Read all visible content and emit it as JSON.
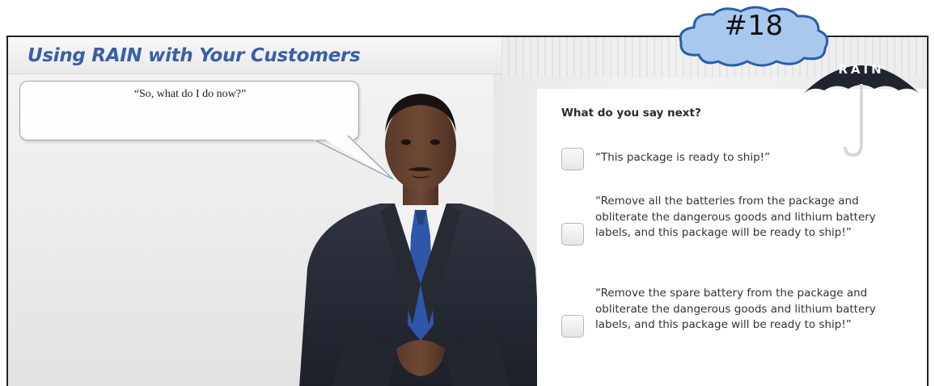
{
  "header": {
    "title": "Using RAIN with Your Customers"
  },
  "speech_bubble": {
    "quote": "“So, what do I do now?”"
  },
  "quiz": {
    "question": "What do you say next?",
    "options": [
      {
        "label": "“This package is ready to ship!”",
        "checked": false
      },
      {
        "label": "“Remove all the batteries from the package and obliterate the dangerous goods and lithium battery labels, and this package will be ready to ship!”",
        "checked": false
      },
      {
        "label": "“Remove the spare battery from the package and obliterate the dangerous goods and lithium battery labels, and this package will be ready to ship!”",
        "checked": false
      }
    ]
  },
  "logo": {
    "text": "RAIN",
    "icon": "umbrella-icon"
  },
  "annotation": {
    "label": "#18",
    "color": "#a9c8ee"
  },
  "colors": {
    "title": "#3a5fa6",
    "umbrella": "#1f2430",
    "umbrella_handle": "#d7d7d7"
  }
}
